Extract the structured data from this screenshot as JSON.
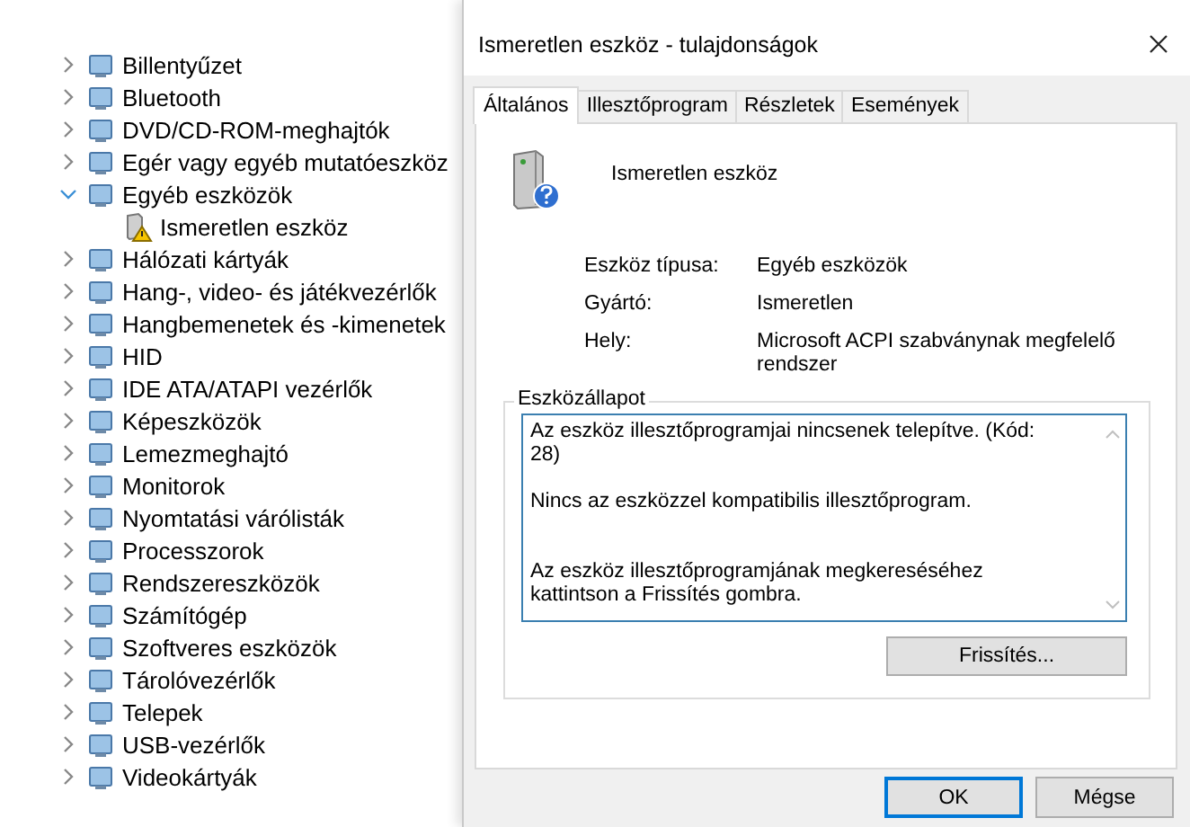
{
  "device_tree": {
    "items": [
      {
        "label": "Billentyűzet",
        "expanded": false
      },
      {
        "label": "Bluetooth",
        "expanded": false
      },
      {
        "label": "DVD/CD-ROM-meghajtók",
        "expanded": false
      },
      {
        "label": "Egér vagy egyéb mutatóeszköz",
        "expanded": false
      },
      {
        "label": "Egyéb eszközök",
        "expanded": true,
        "children": [
          {
            "label": "Ismeretlen eszköz",
            "warning": true
          }
        ]
      },
      {
        "label": "Hálózati kártyák",
        "expanded": false
      },
      {
        "label": "Hang-, video- és játékvezérlők",
        "expanded": false
      },
      {
        "label": "Hangbemenetek és -kimenetek",
        "expanded": false
      },
      {
        "label": "HID",
        "expanded": false
      },
      {
        "label": "IDE ATA/ATAPI vezérlők",
        "expanded": false
      },
      {
        "label": "Képeszközök",
        "expanded": false
      },
      {
        "label": "Lemezmeghajtó",
        "expanded": false
      },
      {
        "label": "Monitorok",
        "expanded": false
      },
      {
        "label": "Nyomtatási várólisták",
        "expanded": false
      },
      {
        "label": "Processzorok",
        "expanded": false
      },
      {
        "label": "Rendszereszközök",
        "expanded": false
      },
      {
        "label": "Számítógép",
        "expanded": false
      },
      {
        "label": "Szoftveres eszközök",
        "expanded": false
      },
      {
        "label": "Tárolóvezérlők",
        "expanded": false
      },
      {
        "label": "Telepek",
        "expanded": false
      },
      {
        "label": "USB-vezérlők",
        "expanded": false
      },
      {
        "label": "Videokártyák",
        "expanded": false
      }
    ]
  },
  "dialog": {
    "title": "Ismeretlen eszköz - tulajdonságok",
    "tabs": [
      {
        "label": "Általános",
        "selected": true
      },
      {
        "label": "Illesztőprogram",
        "selected": false
      },
      {
        "label": "Részletek",
        "selected": false
      },
      {
        "label": "Események",
        "selected": false
      }
    ],
    "device_name": "Ismeretlen eszköz",
    "properties": [
      {
        "label": "Eszköz típusa:",
        "value": "Egyéb eszközök"
      },
      {
        "label": "Gyártó:",
        "value": "Ismeretlen"
      },
      {
        "label": "Hely:",
        "value": "Microsoft ACPI szabványnak megfelelő rendszer"
      }
    ],
    "status_group": {
      "title": "Eszközállapot",
      "text": "Az eszköz illesztőprogramjai nincsenek telepítve. (Kód: 28)\n\nNincs az eszközzel kompatibilis illesztőprogram.\n\n\nAz eszköz illesztőprogramjának megkereséséhez kattintson a Frissítés gombra.",
      "button": "Frissítés..."
    },
    "buttons": [
      {
        "label": "OK",
        "default": true
      },
      {
        "label": "Mégse",
        "default": false
      }
    ]
  }
}
